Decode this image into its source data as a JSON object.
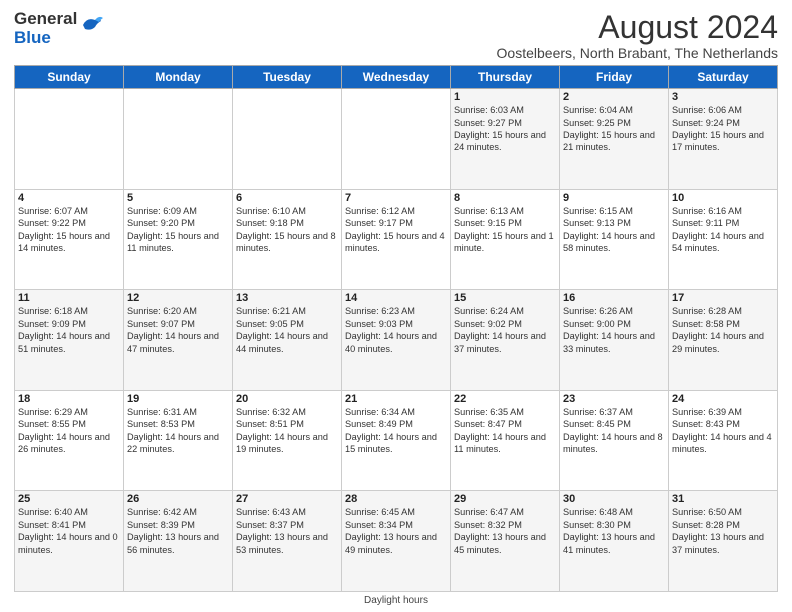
{
  "logo": {
    "general": "General",
    "blue": "Blue"
  },
  "header": {
    "title": "August 2024",
    "subtitle": "Oostelbeers, North Brabant, The Netherlands"
  },
  "days_of_week": [
    "Sunday",
    "Monday",
    "Tuesday",
    "Wednesday",
    "Thursday",
    "Friday",
    "Saturday"
  ],
  "footer": {
    "legend_label": "Daylight hours"
  },
  "weeks": [
    [
      {
        "day": "",
        "info": ""
      },
      {
        "day": "",
        "info": ""
      },
      {
        "day": "",
        "info": ""
      },
      {
        "day": "",
        "info": ""
      },
      {
        "day": "1",
        "info": "Sunrise: 6:03 AM\nSunset: 9:27 PM\nDaylight: 15 hours\nand 24 minutes."
      },
      {
        "day": "2",
        "info": "Sunrise: 6:04 AM\nSunset: 9:25 PM\nDaylight: 15 hours\nand 21 minutes."
      },
      {
        "day": "3",
        "info": "Sunrise: 6:06 AM\nSunset: 9:24 PM\nDaylight: 15 hours\nand 17 minutes."
      }
    ],
    [
      {
        "day": "4",
        "info": "Sunrise: 6:07 AM\nSunset: 9:22 PM\nDaylight: 15 hours\nand 14 minutes."
      },
      {
        "day": "5",
        "info": "Sunrise: 6:09 AM\nSunset: 9:20 PM\nDaylight: 15 hours\nand 11 minutes."
      },
      {
        "day": "6",
        "info": "Sunrise: 6:10 AM\nSunset: 9:18 PM\nDaylight: 15 hours\nand 8 minutes."
      },
      {
        "day": "7",
        "info": "Sunrise: 6:12 AM\nSunset: 9:17 PM\nDaylight: 15 hours\nand 4 minutes."
      },
      {
        "day": "8",
        "info": "Sunrise: 6:13 AM\nSunset: 9:15 PM\nDaylight: 15 hours\nand 1 minute."
      },
      {
        "day": "9",
        "info": "Sunrise: 6:15 AM\nSunset: 9:13 PM\nDaylight: 14 hours\nand 58 minutes."
      },
      {
        "day": "10",
        "info": "Sunrise: 6:16 AM\nSunset: 9:11 PM\nDaylight: 14 hours\nand 54 minutes."
      }
    ],
    [
      {
        "day": "11",
        "info": "Sunrise: 6:18 AM\nSunset: 9:09 PM\nDaylight: 14 hours\nand 51 minutes."
      },
      {
        "day": "12",
        "info": "Sunrise: 6:20 AM\nSunset: 9:07 PM\nDaylight: 14 hours\nand 47 minutes."
      },
      {
        "day": "13",
        "info": "Sunrise: 6:21 AM\nSunset: 9:05 PM\nDaylight: 14 hours\nand 44 minutes."
      },
      {
        "day": "14",
        "info": "Sunrise: 6:23 AM\nSunset: 9:03 PM\nDaylight: 14 hours\nand 40 minutes."
      },
      {
        "day": "15",
        "info": "Sunrise: 6:24 AM\nSunset: 9:02 PM\nDaylight: 14 hours\nand 37 minutes."
      },
      {
        "day": "16",
        "info": "Sunrise: 6:26 AM\nSunset: 9:00 PM\nDaylight: 14 hours\nand 33 minutes."
      },
      {
        "day": "17",
        "info": "Sunrise: 6:28 AM\nSunset: 8:58 PM\nDaylight: 14 hours\nand 29 minutes."
      }
    ],
    [
      {
        "day": "18",
        "info": "Sunrise: 6:29 AM\nSunset: 8:55 PM\nDaylight: 14 hours\nand 26 minutes."
      },
      {
        "day": "19",
        "info": "Sunrise: 6:31 AM\nSunset: 8:53 PM\nDaylight: 14 hours\nand 22 minutes."
      },
      {
        "day": "20",
        "info": "Sunrise: 6:32 AM\nSunset: 8:51 PM\nDaylight: 14 hours\nand 19 minutes."
      },
      {
        "day": "21",
        "info": "Sunrise: 6:34 AM\nSunset: 8:49 PM\nDaylight: 14 hours\nand 15 minutes."
      },
      {
        "day": "22",
        "info": "Sunrise: 6:35 AM\nSunset: 8:47 PM\nDaylight: 14 hours\nand 11 minutes."
      },
      {
        "day": "23",
        "info": "Sunrise: 6:37 AM\nSunset: 8:45 PM\nDaylight: 14 hours\nand 8 minutes."
      },
      {
        "day": "24",
        "info": "Sunrise: 6:39 AM\nSunset: 8:43 PM\nDaylight: 14 hours\nand 4 minutes."
      }
    ],
    [
      {
        "day": "25",
        "info": "Sunrise: 6:40 AM\nSunset: 8:41 PM\nDaylight: 14 hours\nand 0 minutes."
      },
      {
        "day": "26",
        "info": "Sunrise: 6:42 AM\nSunset: 8:39 PM\nDaylight: 13 hours\nand 56 minutes."
      },
      {
        "day": "27",
        "info": "Sunrise: 6:43 AM\nSunset: 8:37 PM\nDaylight: 13 hours\nand 53 minutes."
      },
      {
        "day": "28",
        "info": "Sunrise: 6:45 AM\nSunset: 8:34 PM\nDaylight: 13 hours\nand 49 minutes."
      },
      {
        "day": "29",
        "info": "Sunrise: 6:47 AM\nSunset: 8:32 PM\nDaylight: 13 hours\nand 45 minutes."
      },
      {
        "day": "30",
        "info": "Sunrise: 6:48 AM\nSunset: 8:30 PM\nDaylight: 13 hours\nand 41 minutes."
      },
      {
        "day": "31",
        "info": "Sunrise: 6:50 AM\nSunset: 8:28 PM\nDaylight: 13 hours\nand 37 minutes."
      }
    ]
  ]
}
